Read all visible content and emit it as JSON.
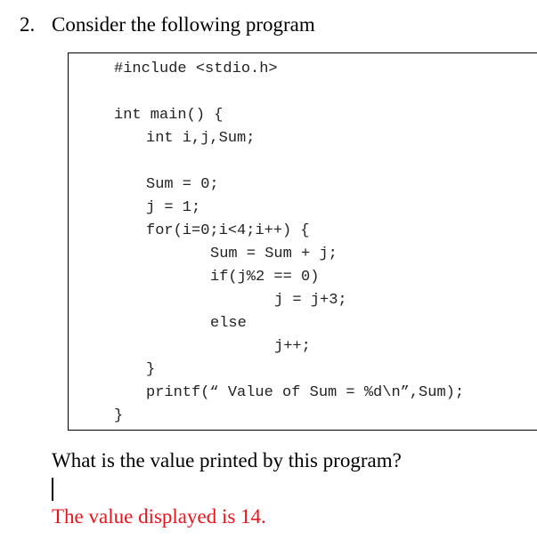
{
  "question": {
    "number": "2.",
    "text": "Consider the following program"
  },
  "code": {
    "lines": [
      "#include <stdio.h>",
      "int main() {",
      "int i,j,Sum;",
      "Sum = 0;",
      "j = 1;",
      "for(i=0;i<4;i++) {",
      "Sum = Sum + j;",
      "if(j%2 == 0)",
      "j = j+3;",
      "else",
      "j++;",
      "}",
      "printf(“ Value of Sum = %d\\n”,Sum);",
      "}"
    ]
  },
  "prompt": "What is the value printed by this program?",
  "answer": {
    "text": "The value displayed is 14.",
    "color": "#e8141c"
  }
}
